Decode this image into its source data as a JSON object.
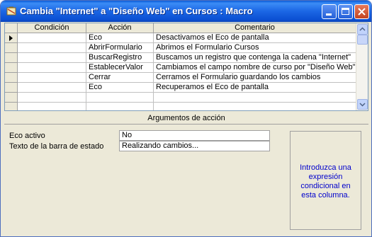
{
  "window": {
    "title": "Cambia \"Internet\" a \"Diseño Web\" en Cursos : Macro"
  },
  "grid": {
    "headers": [
      "Condición",
      "Acción",
      "Comentario"
    ],
    "rows": [
      {
        "condicion": "",
        "accion": "Eco",
        "comentario": "Desactivamos el Eco de pantalla"
      },
      {
        "condicion": "",
        "accion": "AbrirFormulario",
        "comentario": "Abrimos el Formulario Cursos"
      },
      {
        "condicion": "",
        "accion": "BuscarRegistro",
        "comentario": "Buscamos un registro que contenga la cadena \"Internet\""
      },
      {
        "condicion": "",
        "accion": "EstablecerValor",
        "comentario": "Cambiamos el campo nombre de curso por \"Diseño Web\""
      },
      {
        "condicion": "",
        "accion": "Cerrar",
        "comentario": "Cerramos el Formulario guardando los cambios"
      },
      {
        "condicion": "",
        "accion": "Eco",
        "comentario": "Recuperamos el Eco de pantalla"
      },
      {
        "condicion": "",
        "accion": "",
        "comentario": ""
      },
      {
        "condicion": "",
        "accion": "",
        "comentario": ""
      }
    ]
  },
  "arguments": {
    "title": "Argumentos de acción",
    "eco_activo_label": "Eco activo",
    "eco_activo_value": "No",
    "texto_barra_label": "Texto de la barra de estado",
    "texto_barra_value": "Realizando cambios...",
    "help_text": "Introduzca una expresión condicional en esta columna."
  },
  "colors": {
    "titlebar": "#0b57d0",
    "help_text": "#0000cc"
  }
}
